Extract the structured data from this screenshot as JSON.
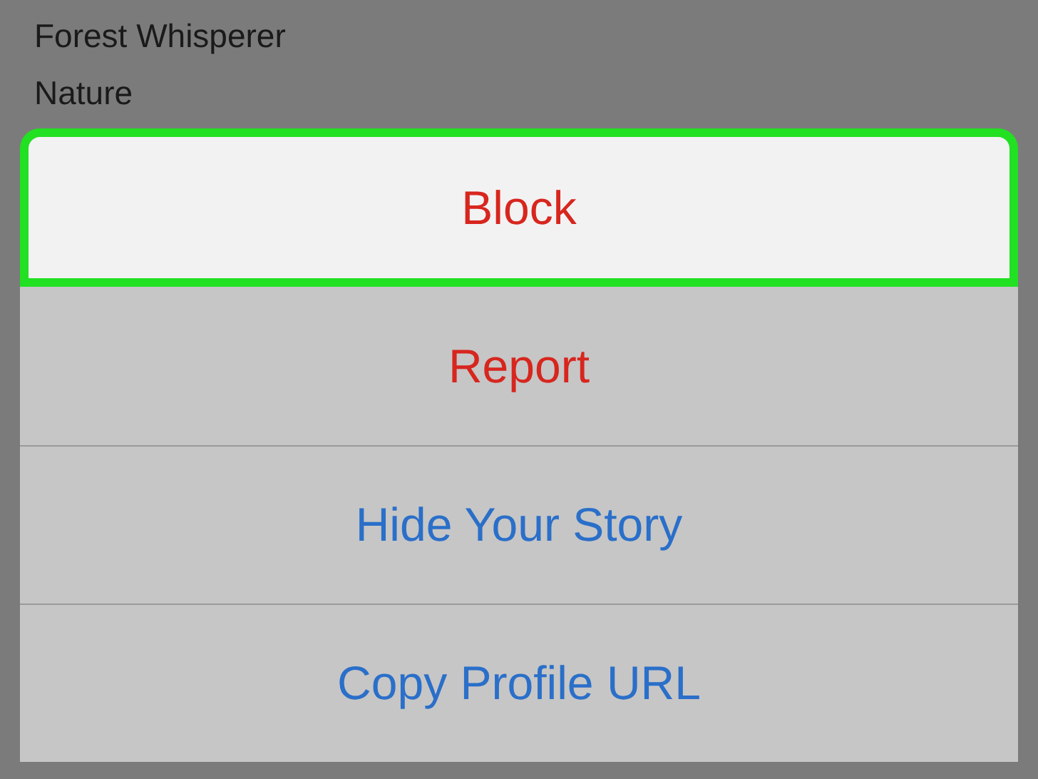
{
  "profile_lines": [
    "Forest Whisperer",
    "Nature"
  ],
  "action_sheet": {
    "actions": [
      {
        "label": "Block",
        "kind": "destructive",
        "selected": true
      },
      {
        "label": "Report",
        "kind": "destructive",
        "selected": false
      },
      {
        "label": "Hide Your Story",
        "kind": "default",
        "selected": false
      },
      {
        "label": "Copy Profile URL",
        "kind": "default",
        "selected": false
      }
    ]
  }
}
